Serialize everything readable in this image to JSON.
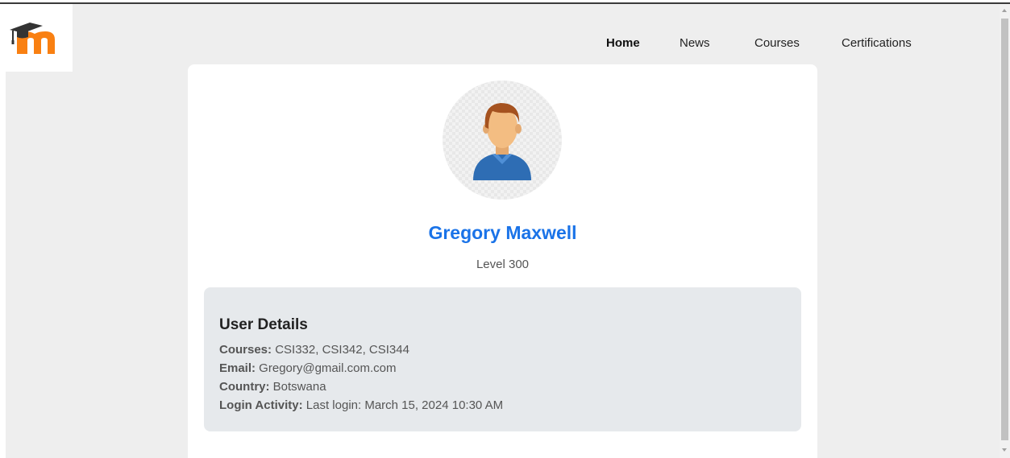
{
  "brand": {
    "logo_icon": "moodle-logo-icon",
    "accent": "#f98012"
  },
  "nav": {
    "items": [
      {
        "label": "Home",
        "active": true
      },
      {
        "label": "News"
      },
      {
        "label": "Courses"
      },
      {
        "label": "Certifications"
      }
    ]
  },
  "profile": {
    "avatar_icon": "user-avatar-icon",
    "name": "Gregory Maxwell",
    "level": "Level 300",
    "name_color": "#1a73e8"
  },
  "details": {
    "title": "User Details",
    "rows": [
      {
        "label": "Courses:",
        "value": " CSI332, CSI342, CSI344"
      },
      {
        "label": "Email:",
        "value": " Gregory@gmail.com.com"
      },
      {
        "label": "Country:",
        "value": " Botswana"
      },
      {
        "label": "Login Activity:",
        "value": " Last login: March 15, 2024 10:30 AM"
      }
    ]
  }
}
